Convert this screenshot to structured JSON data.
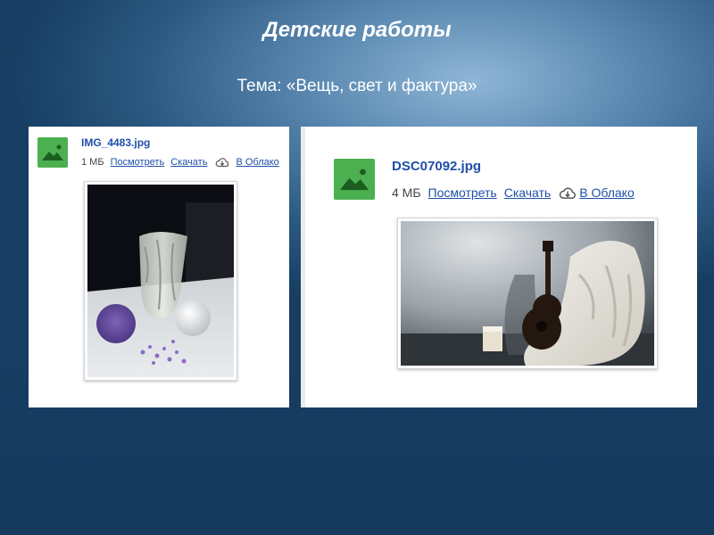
{
  "slide": {
    "title": "Детские работы",
    "subtitle": "Тема: «Вещь, свет и фактура»"
  },
  "attachments": [
    {
      "file_name": "IMG_4483.jpg",
      "size": "1 МБ",
      "view_label": "Посмотреть",
      "download_label": "Скачать",
      "cloud_label": "В Облако",
      "icon": "image-file-icon",
      "preview": "still-life-vase-sphere-pompom-photo"
    },
    {
      "file_name": "DSC07092.jpg",
      "size": "4 МБ",
      "view_label": "Посмотреть",
      "download_label": "Скачать",
      "cloud_label": "В Облако",
      "icon": "image-file-icon",
      "preview": "still-life-ukulele-blanket-photo"
    }
  ],
  "colors": {
    "icon_green": "#4caf50",
    "link_blue": "#1f4fa8"
  }
}
